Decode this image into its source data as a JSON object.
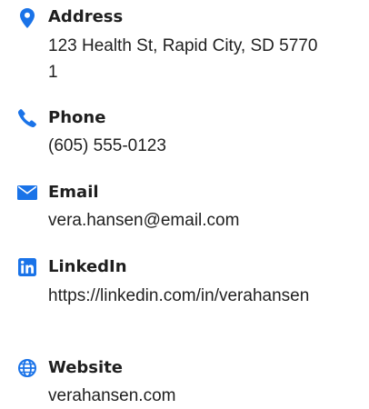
{
  "contact": {
    "accent_color": "#1a73e8",
    "items": [
      {
        "icon": "map-pin-icon",
        "label": "Address",
        "value": "123 Health St, Rapid City, SD 57701"
      },
      {
        "icon": "phone-icon",
        "label": "Phone",
        "value": "(605) 555-0123"
      },
      {
        "icon": "envelope-icon",
        "label": "Email",
        "value": "vera.hansen@email.com"
      },
      {
        "icon": "linkedin-icon",
        "label": "LinkedIn",
        "value": "https://linkedin.com/in/verahansen"
      },
      {
        "icon": "globe-icon",
        "label": "Website",
        "value": "verahansen.com"
      }
    ]
  }
}
